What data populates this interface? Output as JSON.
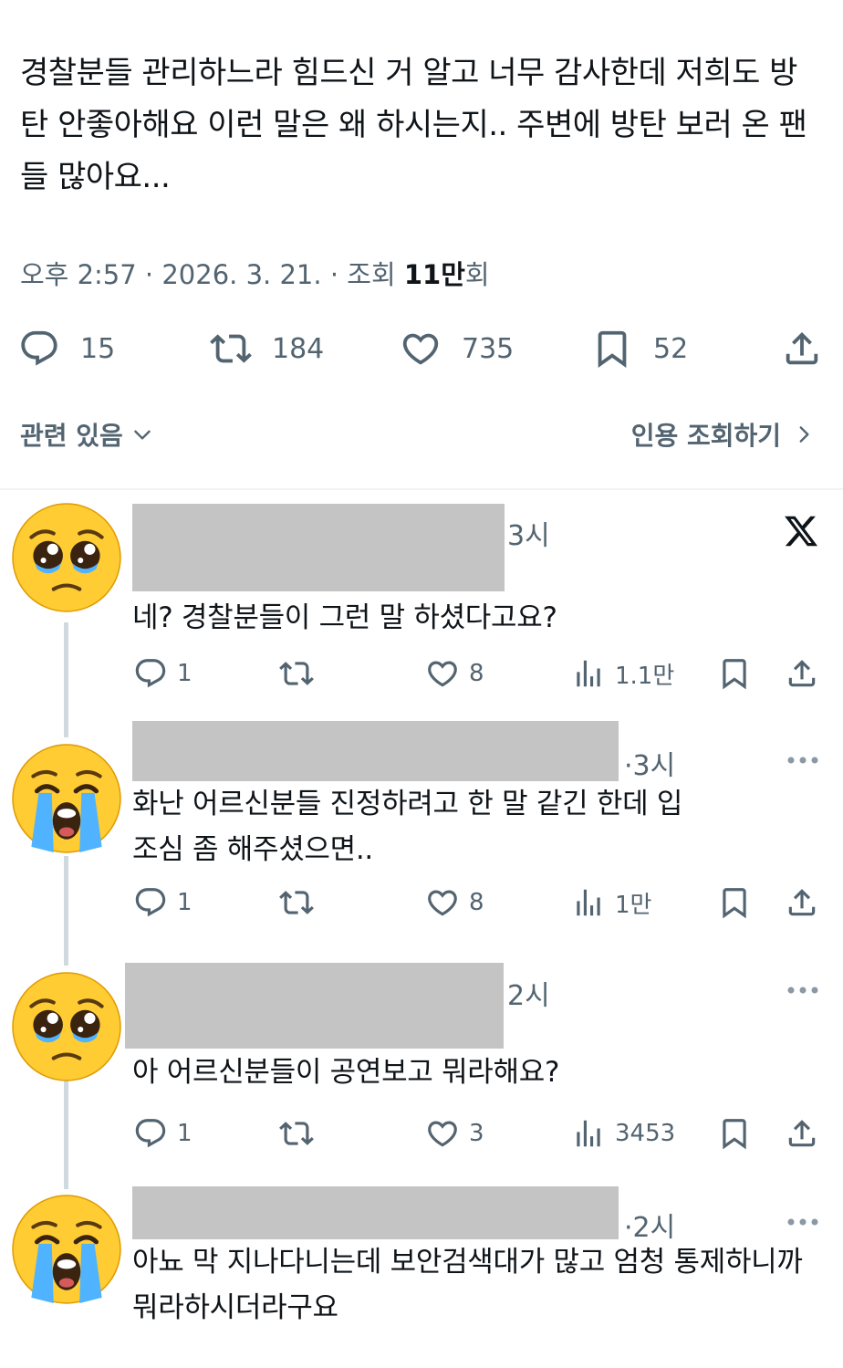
{
  "tweet": {
    "text": "경찰분들 관리하느라 힘드신 거 알고 너무 감사한데 저희도 방탄 안좋아해요 이런 말은 왜 하시는지.. 주변에 방탄 보러 온 팬들 많아요...",
    "time": "오후 2:57",
    "date": "2026. 3. 21.",
    "views_label": "조회",
    "views_count": "11만",
    "views_suffix": "회",
    "sep": "·"
  },
  "actions": {
    "replies": "15",
    "retweets": "184",
    "likes": "735",
    "bookmarks": "52"
  },
  "related": {
    "label": "관련 있음",
    "quotes_label": "인용 조회하기"
  },
  "replies": [
    {
      "avatar": "pleading-face-emoji",
      "time": "3시",
      "text": "네? 경찰분들이 그런 말 하셨다고요?",
      "stats": {
        "replies": "1",
        "likes": "8",
        "views": "1.1만"
      },
      "menu": "x-logo"
    },
    {
      "avatar": "loudly-crying-face-emoji",
      "time": "·3시",
      "text": "화난 어르신분들 진정하려고 한 말 같긴 한데 입조심 좀 해주셨으면..",
      "stats": {
        "replies": "1",
        "likes": "8",
        "views": "1만"
      },
      "menu": "more-icon"
    },
    {
      "avatar": "pleading-face-emoji",
      "time": "2시",
      "text": "아 어르신분들이 공연보고 뭐라해요?",
      "stats": {
        "replies": "1",
        "likes": "3",
        "views": "3453"
      },
      "menu": "more-icon"
    },
    {
      "avatar": "loudly-crying-face-emoji",
      "time": "·2시",
      "text": "아뇨 막 지나다니는데 보안검색대가 많고 엄청 통제하니까 뭐라하시더라구요",
      "stats": {},
      "menu": "more-icon"
    }
  ],
  "colors": {
    "text": "#0f1419",
    "secondary": "#536471",
    "thread_line": "#cfd9de",
    "redacted": "#c4c4c4"
  }
}
